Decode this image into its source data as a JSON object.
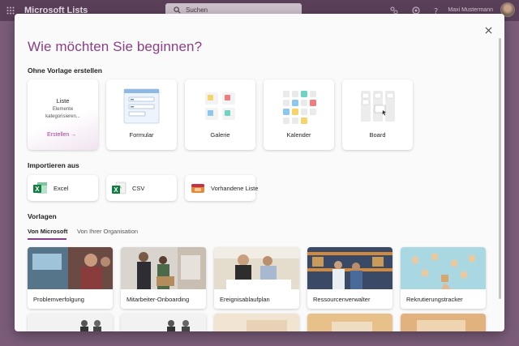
{
  "app": {
    "title": "Microsoft Lists",
    "search_placeholder": "Suchen",
    "user_name": "Maxi Mustermann"
  },
  "dialog": {
    "title": "Wie möchten Sie beginnen?",
    "blank_section": "Ohne Vorlage erstellen",
    "blank_cards": [
      {
        "label": "Liste",
        "description": "Elemente kategorisieren...",
        "action": "Erstellen →"
      },
      {
        "label": "Formular"
      },
      {
        "label": "Galerie"
      },
      {
        "label": "Kalender"
      },
      {
        "label": "Board"
      }
    ],
    "import_section": "Importieren aus",
    "import_cards": [
      {
        "label": "Excel"
      },
      {
        "label": "CSV"
      },
      {
        "label": "Vorhandene Liste"
      }
    ],
    "templates_section": "Vorlagen",
    "tabs": [
      {
        "label": "Von Microsoft",
        "active": true
      },
      {
        "label": "Von Ihrer Organisation",
        "active": false
      }
    ],
    "templates": [
      {
        "label": "Problemverfolgung"
      },
      {
        "label": "Mitarbeiter-Onboarding"
      },
      {
        "label": "Ereignisablaufplan"
      },
      {
        "label": "Ressourcenverwalter"
      },
      {
        "label": "Rekrutierungstracker"
      }
    ]
  },
  "colors": {
    "accent": "#8b3f86",
    "appbar": "#5a3f58",
    "backdrop": "#7a5c78"
  }
}
